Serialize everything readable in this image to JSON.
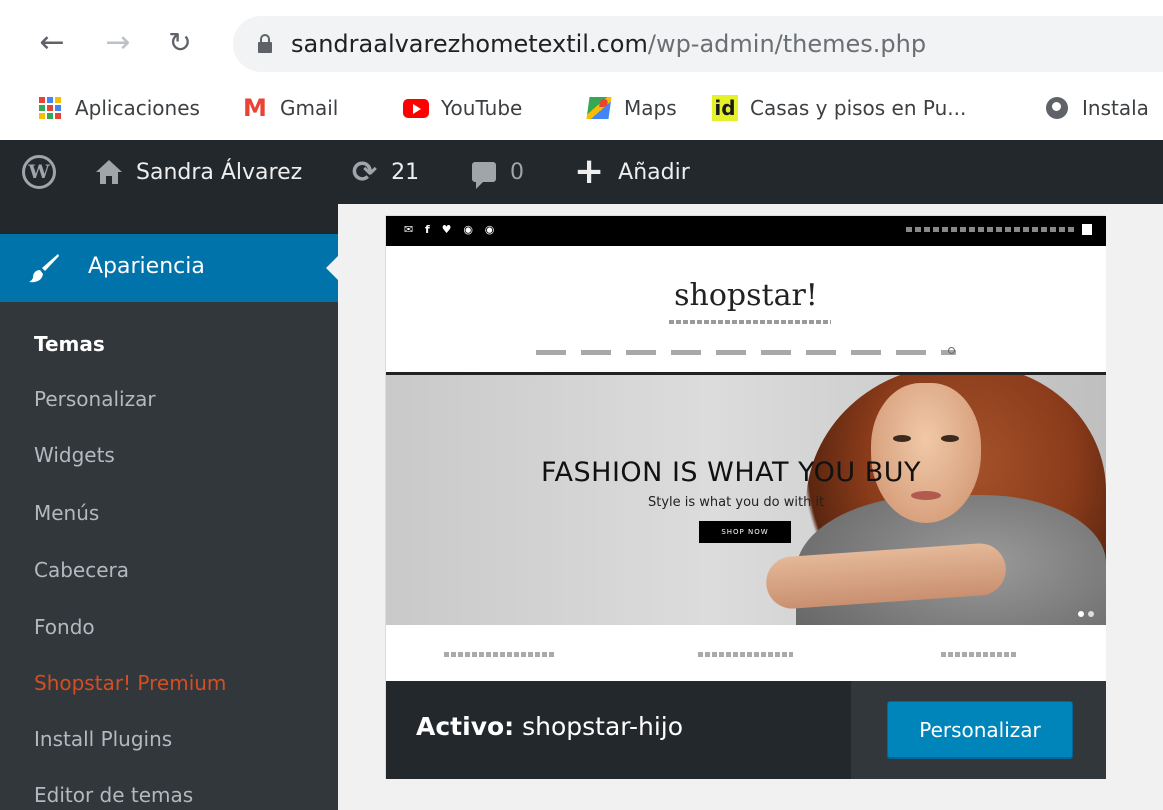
{
  "browser": {
    "url_host": "sandraalvarezhometextil.com",
    "url_path": "/wp-admin/themes.php",
    "bookmarks": [
      {
        "label": "Aplicaciones",
        "icon": "apps-grid-icon"
      },
      {
        "label": "Gmail",
        "icon": "gmail-icon"
      },
      {
        "label": "YouTube",
        "icon": "youtube-icon"
      },
      {
        "label": "Maps",
        "icon": "maps-icon"
      },
      {
        "label": "Casas y pisos en Pu...",
        "icon": "idealista-icon",
        "icon_text": "id"
      },
      {
        "label": "Instala",
        "icon": "globe-icon"
      }
    ]
  },
  "adminbar": {
    "site_name": "Sandra Álvarez",
    "updates_count": "21",
    "comments_count": "0",
    "new_label": "Añadir"
  },
  "sidebar": {
    "current_menu": "Apariencia",
    "submenu": [
      {
        "label": "Temas",
        "state": "current"
      },
      {
        "label": "Personalizar",
        "state": "normal"
      },
      {
        "label": "Widgets",
        "state": "normal"
      },
      {
        "label": "Menús",
        "state": "normal"
      },
      {
        "label": "Cabecera",
        "state": "normal"
      },
      {
        "label": "Fondo",
        "state": "normal"
      },
      {
        "label": "Shopstar! Premium",
        "state": "highlight"
      },
      {
        "label": "Install Plugins",
        "state": "normal"
      },
      {
        "label": "Editor de temas",
        "state": "normal"
      }
    ]
  },
  "theme_card": {
    "preview": {
      "logo": "shopstar!",
      "hero_title": "FASHION IS WHAT YOU BUY",
      "hero_subtitle": "Style is what you do with it",
      "hero_button": "SHOP NOW"
    },
    "active_prefix": "Activo:",
    "active_theme": "shopstar-hijo",
    "customize_button": "Personalizar"
  },
  "colors": {
    "adminbar_bg": "#23282d",
    "menu_current_bg": "#0073aa",
    "submenu_bg": "#32373c",
    "highlight_text": "#d54e21",
    "primary_button": "#0085ba"
  }
}
